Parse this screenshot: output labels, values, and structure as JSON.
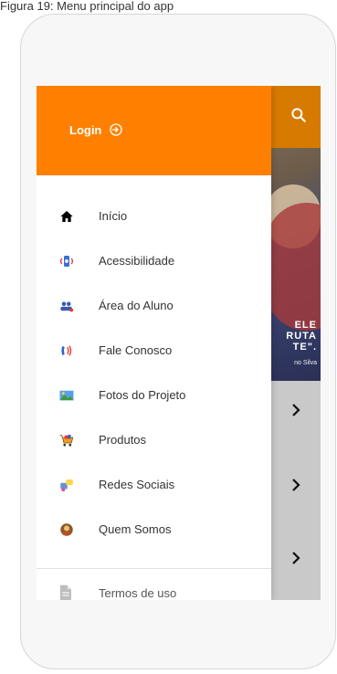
{
  "caption": "Figura 19: Menu principal do app",
  "header": {
    "login_label": "Login"
  },
  "menu": {
    "items": [
      {
        "label": "Início",
        "icon": "home-icon"
      },
      {
        "label": "Acessibilidade",
        "icon": "accessibility-icon"
      },
      {
        "label": "Área do Aluno",
        "icon": "students-icon"
      },
      {
        "label": "Fale Conosco",
        "icon": "phone-icon"
      },
      {
        "label": "Fotos do Projeto",
        "icon": "photos-icon"
      },
      {
        "label": "Produtos",
        "icon": "cart-icon"
      },
      {
        "label": "Redes Sociais",
        "icon": "social-icon"
      },
      {
        "label": "Quem Somos",
        "icon": "about-icon"
      }
    ],
    "terms_label": "Termos de uso"
  },
  "background": {
    "hero_text_lines": [
      "ELE",
      "RUTA",
      "TE\"."
    ],
    "hero_author": "no Silva"
  },
  "colors": {
    "drawer_header": "#ff8000",
    "app_header": "#d67a00"
  }
}
